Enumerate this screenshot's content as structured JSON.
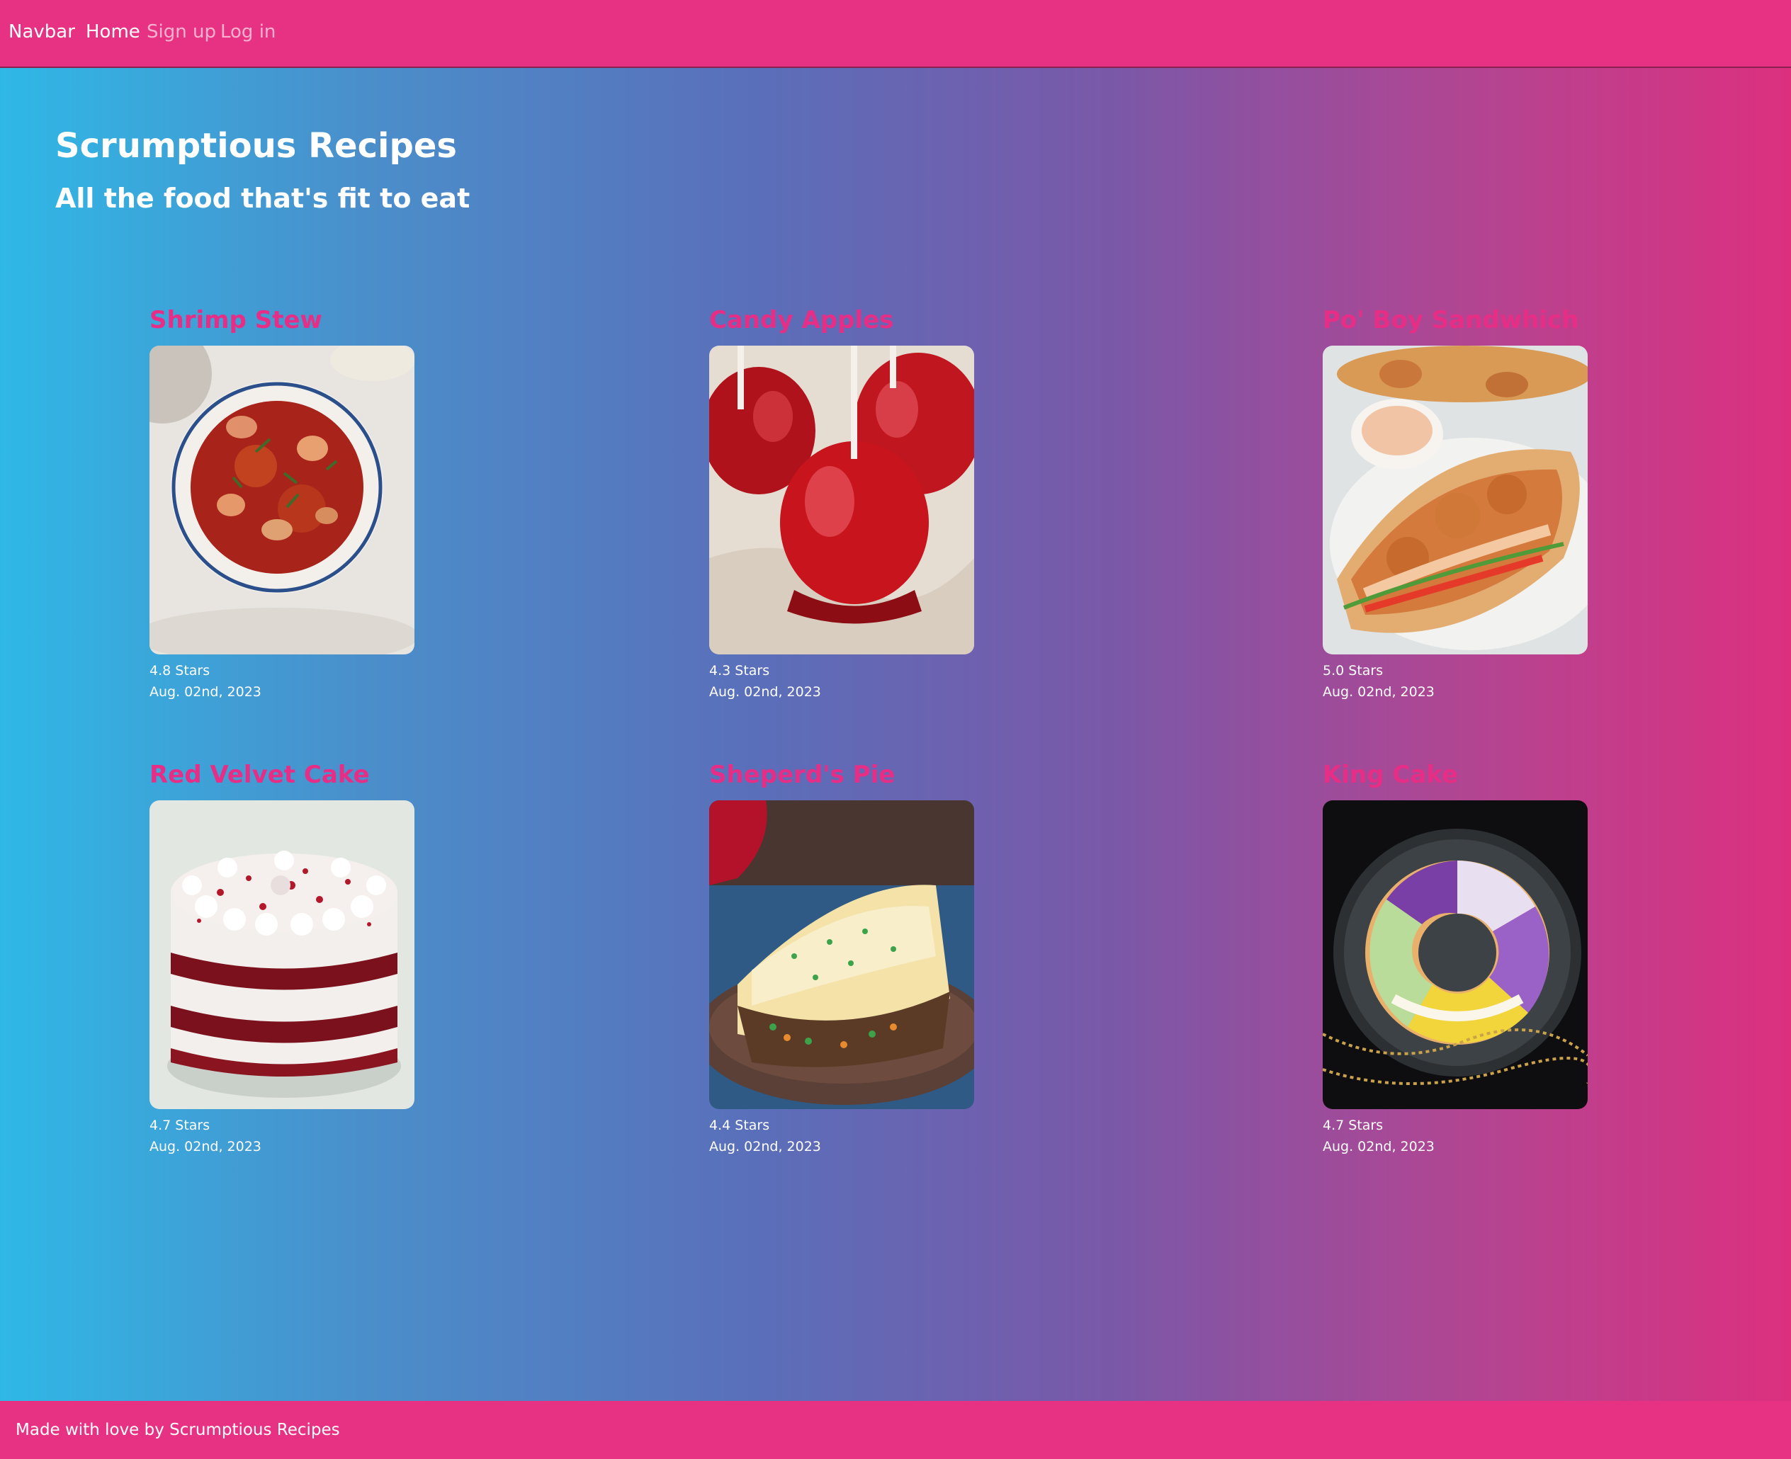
{
  "navbar": {
    "brand": "Navbar",
    "links": [
      {
        "label": "Home",
        "active": true
      },
      {
        "label": "Sign up",
        "active": false
      },
      {
        "label": "Log in",
        "active": false
      }
    ]
  },
  "hero": {
    "title": "Scrumptious Recipes",
    "subtitle": "All the food that's fit to eat"
  },
  "recipes": [
    {
      "title": "Shrimp Stew",
      "rating": "4.8 Stars",
      "date": "Aug. 02nd, 2023",
      "image_icon": "shrimp-stew-photo"
    },
    {
      "title": "Candy Apples",
      "rating": "4.3 Stars",
      "date": "Aug. 02nd, 2023",
      "image_icon": "candy-apples-photo"
    },
    {
      "title": "Po' Boy Sandwhich",
      "rating": "5.0 Stars",
      "date": "Aug. 02nd, 2023",
      "image_icon": "po-boy-sandwich-photo"
    },
    {
      "title": "Red Velvet Cake",
      "rating": "4.7 Stars",
      "date": "Aug. 02nd, 2023",
      "image_icon": "red-velvet-cake-photo"
    },
    {
      "title": "Sheperd's Pie",
      "rating": "4.4 Stars",
      "date": "Aug. 02nd, 2023",
      "image_icon": "shepherds-pie-photo"
    },
    {
      "title": "King Cake",
      "rating": "4.7 Stars",
      "date": "Aug. 02nd, 2023",
      "image_icon": "king-cake-photo"
    }
  ],
  "footer": {
    "text": "Made with love by Scrumptious Recipes"
  },
  "colors": {
    "navbar_bg": "#e73283",
    "recipe_title": "#e62e86",
    "gradient_start": "#2fb8e6",
    "gradient_end": "#dc307f"
  }
}
